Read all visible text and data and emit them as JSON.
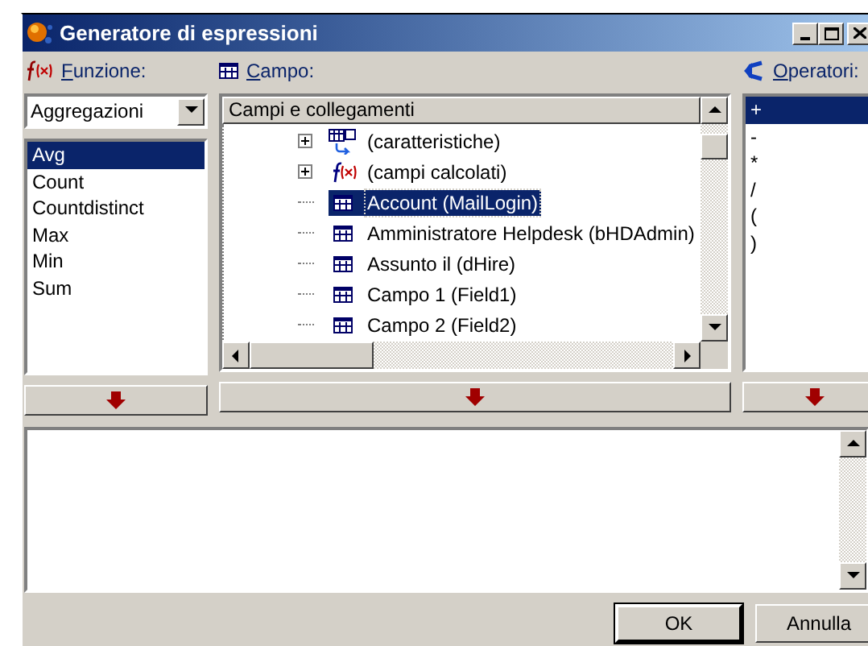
{
  "window": {
    "title": "Generatore di espressioni"
  },
  "functions": {
    "label": "Funzione:",
    "category": "Aggregazioni",
    "items": [
      {
        "label": "Avg",
        "selected": true
      },
      {
        "label": "Count",
        "selected": false
      },
      {
        "label": "Countdistinct",
        "selected": false
      },
      {
        "label": "Max",
        "selected": false
      },
      {
        "label": "Min",
        "selected": false
      },
      {
        "label": "Sum",
        "selected": false
      }
    ]
  },
  "fields": {
    "label": "Campo:",
    "header": "Campi e collegamenti",
    "tree": [
      {
        "label": "(caratteristiche)",
        "kind": "features",
        "expanded": false,
        "selected": false
      },
      {
        "label": "(campi calcolati)",
        "kind": "calculated",
        "expanded": false,
        "selected": false
      },
      {
        "label": "Account (MailLogin)",
        "kind": "field",
        "selected": true
      },
      {
        "label": "Amministratore Helpdesk (bHDAdmin)",
        "kind": "field",
        "selected": false
      },
      {
        "label": "Assunto il (dHire)",
        "kind": "field",
        "selected": false
      },
      {
        "label": "Campo 1 (Field1)",
        "kind": "field",
        "selected": false
      },
      {
        "label": "Campo 2 (Field2)",
        "kind": "field",
        "selected": false
      }
    ]
  },
  "operators": {
    "label": "Operatori:",
    "items": [
      {
        "label": "+",
        "selected": true
      },
      {
        "label": "-",
        "selected": false
      },
      {
        "label": "*",
        "selected": false
      },
      {
        "label": "/",
        "selected": false
      },
      {
        "label": "(",
        "selected": false
      },
      {
        "label": ")",
        "selected": false
      }
    ]
  },
  "buttons": [
    {
      "label": "OK",
      "default": true
    },
    {
      "label": "Annulla",
      "default": false
    }
  ]
}
